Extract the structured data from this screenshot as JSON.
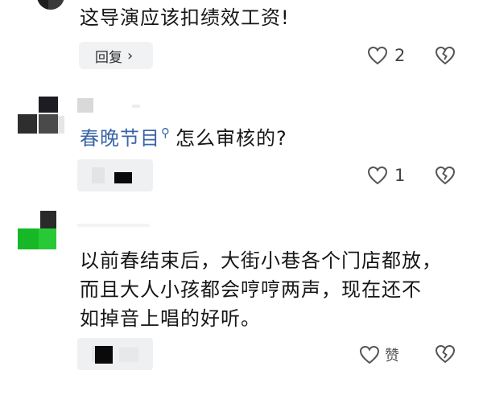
{
  "comments": [
    {
      "text": "这导演应该扣绩效工资!",
      "reply_label": "回复",
      "reply_chevron": "›",
      "like_count": "2"
    },
    {
      "mention": "春晚节目",
      "mention_icon": "search-icon",
      "text": "怎么审核的?",
      "like_count": "1"
    },
    {
      "lines": [
        "以前春结束后，大街小巷各个门店都放，",
        "而且大人小孩都会哼哼两声，现在还不",
        "如掉音上唱的好听。"
      ],
      "like_label": "赞"
    }
  ],
  "colors": {
    "mention": "#3b64a9",
    "avatar_green": "#1dbb2a",
    "pill_bg": "#f1f2f4"
  }
}
